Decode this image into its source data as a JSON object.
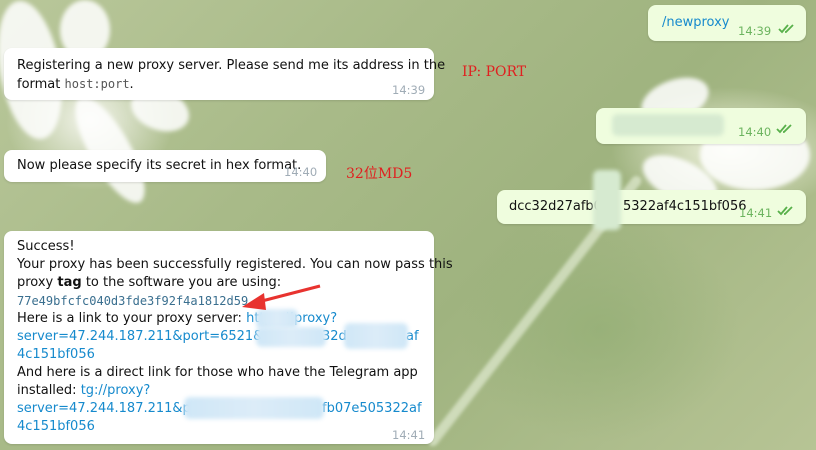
{
  "messages": {
    "cmd": {
      "text": "/newproxy",
      "time": "14:39"
    },
    "reg": {
      "line1": "Registering a new proxy server. Please send me its address in the",
      "line2_prefix": "format ",
      "line2_code": "host:port",
      "line2_suffix": ".",
      "time": "14:39"
    },
    "ipport": {
      "time": "14:40"
    },
    "secret_req": {
      "text": "Now please specify its secret in hex format.",
      "time": "14:40"
    },
    "secret": {
      "left": "dcc32d27afb0",
      "right": "5322af4c151bf056",
      "time": "14:41"
    },
    "success": {
      "l1": "Success!",
      "l2": "Your proxy has been successfully registered. You can now pass this",
      "l3_a": "proxy ",
      "l3_b": "tag",
      "l3_c": " to the software you are using:",
      "tag": "77e49bfcfc040d3fde3f92f4a1812d59",
      "l5_a": "Here is a link to your proxy server: ",
      "l5_link": "https://",
      "l5_link2": "proxy?",
      "l6_a": "server=47.244.187.211&port=6521&secr",
      "l6_b": "32d",
      "l6_c": "af",
      "l7": "4c151bf056",
      "l8": "And here is a direct link for those who have the Telegram app",
      "l9_a": "installed: ",
      "l9_link": "tg://proxy?",
      "l10_a": "server=47.244.187.211&port",
      "l10_b": "fb07e505322af",
      "l11": "4c151bf056",
      "time": "14:41"
    }
  },
  "annotations": {
    "ipport_label": "IP: PORT",
    "md5_label": "32位MD5",
    "arrow_color": "#e8332f"
  },
  "colors": {
    "incoming_bubble": "#ffffff",
    "outgoing_bubble": "#effdde",
    "link": "#168acd",
    "read_check": "#58b04a"
  }
}
